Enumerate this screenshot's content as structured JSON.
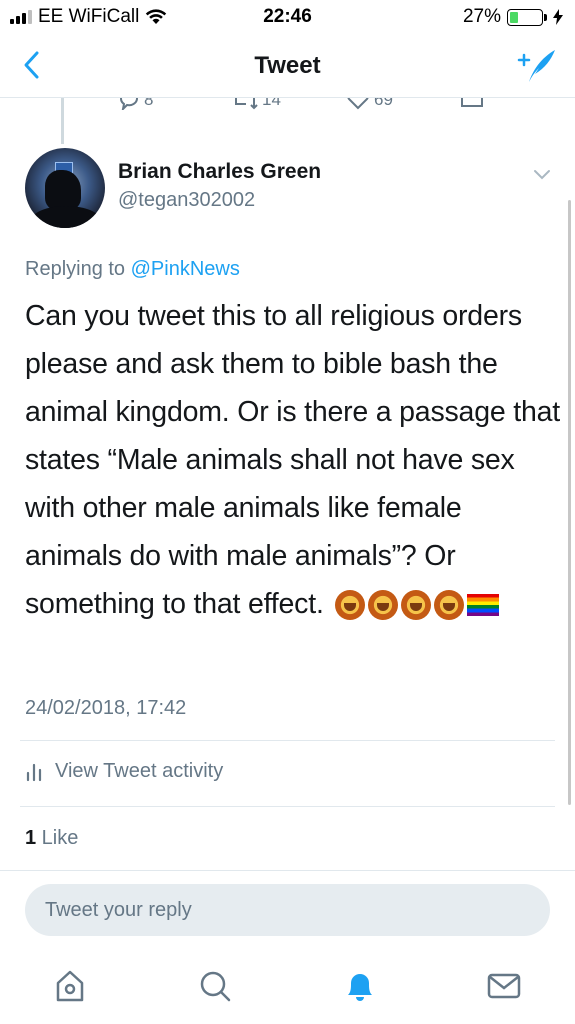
{
  "status_bar": {
    "carrier": "EE WiFiCall",
    "time": "22:46",
    "battery": "27%"
  },
  "nav": {
    "title": "Tweet"
  },
  "prev_tweet": {
    "replies": "8",
    "retweets": "14",
    "likes": "69"
  },
  "tweet": {
    "author_name": "Brian Charles Green",
    "author_handle": "@tegan302002",
    "replying_prefix": "Replying to ",
    "replying_to": "@PinkNews",
    "text": "Can you tweet this to all religious orders please and ask them to bible bash the animal kingdom. Or is there a passage that states “Male animals shall not have sex with other male animals like female animals do with male animals”? Or something to that effect.",
    "timestamp": "24/02/2018, 17:42",
    "activity_label": "View Tweet activity",
    "like_count": "1",
    "like_label": " Like"
  },
  "reply": {
    "placeholder": "Tweet your reply"
  },
  "colors": {
    "accent": "#1da1f2",
    "secondary": "#657786",
    "text": "#14171a",
    "divider": "#e1e8ed"
  },
  "icons": [
    "back-icon",
    "compose-icon",
    "reply-icon",
    "retweet-icon",
    "like-icon",
    "share-icon",
    "caret-down-icon",
    "activity-icon",
    "home-icon",
    "search-icon",
    "notifications-icon",
    "messages-icon"
  ]
}
